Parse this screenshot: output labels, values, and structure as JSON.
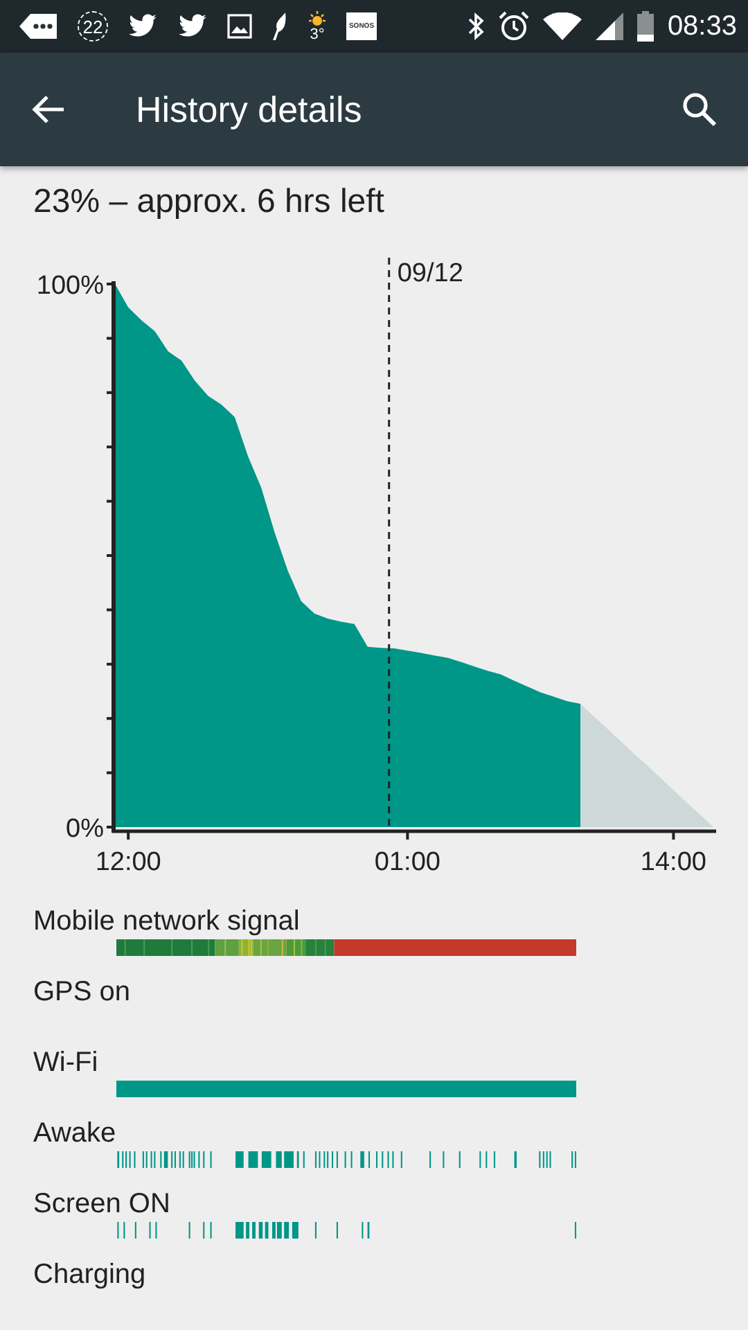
{
  "status_bar": {
    "notifications": [
      {
        "kind": "more"
      },
      {
        "kind": "count",
        "text": "22"
      },
      {
        "kind": "bird"
      },
      {
        "kind": "bird"
      },
      {
        "kind": "image"
      },
      {
        "kind": "feather"
      },
      {
        "kind": "weather",
        "text": "3°"
      },
      {
        "kind": "logo",
        "text": "SONOS"
      }
    ],
    "time": "08:33"
  },
  "app_bar": {
    "title": "History details"
  },
  "summary": "23% – approx. 6 hrs left",
  "chart_data": {
    "type": "area",
    "categories": [
      null,
      "12:00",
      null,
      null,
      null,
      null,
      null,
      null,
      null,
      null,
      null,
      null,
      null,
      null,
      null,
      null,
      null,
      null,
      null,
      null,
      null,
      null,
      "01:00",
      null,
      null,
      null,
      null,
      null,
      null,
      null,
      null,
      null,
      null,
      null,
      null,
      null,
      null,
      null,
      null,
      null,
      null,
      null,
      "14:00",
      null,
      null,
      null
    ],
    "series": [
      {
        "color": "#009688",
        "values": [
          100,
          95.7,
          93.3,
          91.3,
          87.6,
          85.9,
          82.2,
          79.4,
          77.8,
          75.5,
          68.3,
          62.5,
          54.3,
          47.2,
          41.6,
          39.3,
          38.4,
          37.8,
          37.4,
          33.2,
          33.0,
          32.9,
          32.5,
          32.1,
          31.6,
          31.2,
          30.4,
          29.6,
          28.8,
          28.1,
          27.0,
          25.9,
          24.8,
          24.0,
          23.2,
          22.7,
          null,
          null,
          null,
          null,
          null,
          null,
          null,
          null,
          null,
          null
        ]
      },
      {
        "color": "#cfd8d8",
        "values": [
          null,
          null,
          null,
          null,
          null,
          null,
          null,
          null,
          null,
          null,
          null,
          null,
          null,
          null,
          null,
          null,
          null,
          null,
          null,
          null,
          null,
          null,
          null,
          null,
          null,
          null,
          null,
          null,
          null,
          null,
          null,
          null,
          null,
          null,
          null,
          22.7,
          20.4,
          18.2,
          15.9,
          13.6,
          11.4,
          9.1,
          6.8,
          4.5,
          2.3,
          0
        ]
      }
    ],
    "ylim": [
      0,
      100
    ],
    "yticks": [
      {
        "value": 0,
        "label": "0%"
      },
      {
        "value": 100,
        "label": "100%"
      }
    ],
    "annotations": [
      "09/12"
    ]
  },
  "timelines": [
    {
      "label": "Mobile network signal",
      "kind": "signal"
    },
    {
      "label": "GPS on",
      "kind": "none"
    },
    {
      "label": "Wi-Fi",
      "kind": "bar"
    },
    {
      "label": "Awake",
      "kind": "ticks"
    },
    {
      "label": "Screen ON",
      "kind": "ticks"
    },
    {
      "label": "Charging",
      "kind": "none"
    }
  ]
}
